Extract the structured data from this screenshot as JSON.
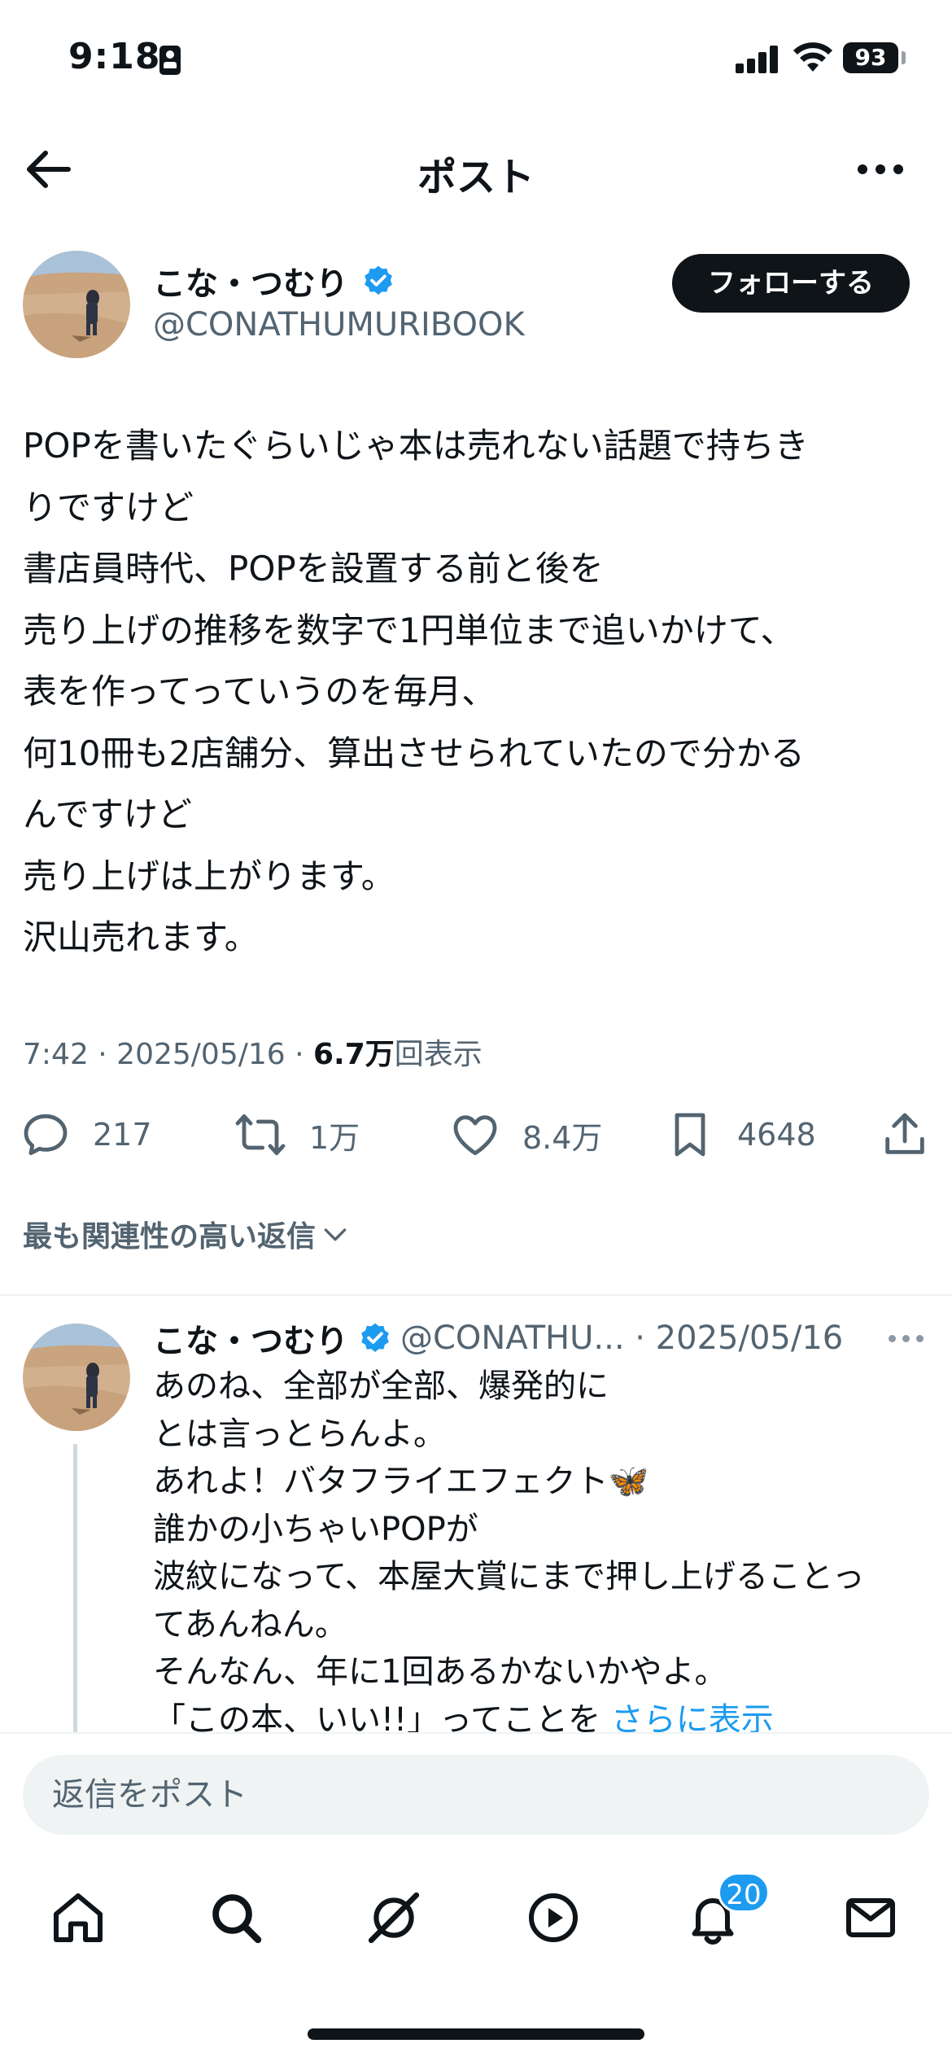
{
  "status_bar": {
    "time": "9:18",
    "battery": "93"
  },
  "nav": {
    "title": "ポスト"
  },
  "post": {
    "author_name": "こな・つむり",
    "author_handle": "@CONATHUMURIBOOK",
    "follow_label": "フォローする",
    "body_lines": [
      "POPを書いたぐらいじゃ本は売れない話題で持ちき",
      "りですけど",
      "書店員時代、POPを設置する前と後を",
      "売り上げの推移を数字で1円単位まで追いかけて、",
      "表を作ってっていうのを毎月、",
      "何10冊も2店舗分、算出させられていたので分かる",
      "んですけど",
      "売り上げは上がります。",
      "沢山売れます。"
    ],
    "timestamp": "7:42 · 2025/05/16 · ",
    "views_count": "6.7万",
    "views_label": "回表示",
    "actions": {
      "replies": "217",
      "reposts": "1万",
      "likes": "8.4万",
      "bookmarks": "4648"
    }
  },
  "replies_filter": {
    "label": "最も関連性の高い返信"
  },
  "reply": {
    "author_name": "こな・つむり",
    "handle_date": "@CONATHU... · 2025/05/16",
    "body_lines": [
      "あのね、全部が全部、爆発的に",
      "とは言っとらんよ。",
      "あれよ！バタフライエフェクト🦋",
      "誰かの小ちゃいPOPが",
      "波紋になって、本屋大賞にまで押し上げることっ",
      "てあんねん。",
      "そんなん、年に1回あるかないかやよ。"
    ],
    "last_line": "「この本、いい!!」ってことを ",
    "show_more": "さらに表示"
  },
  "compose": {
    "placeholder": "返信をポスト"
  },
  "tab_bar": {
    "notification_badge": "20"
  },
  "colors": {
    "accent": "#1d9bf0",
    "text": "#0f1419",
    "muted": "#536471"
  }
}
